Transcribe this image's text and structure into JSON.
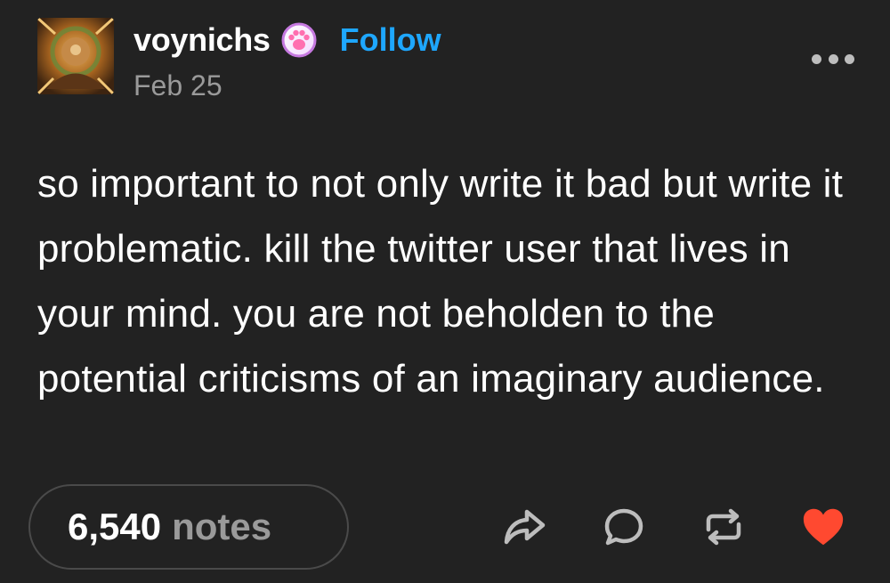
{
  "post": {
    "username": "voynichs",
    "follow_label": "Follow",
    "date": "Feb 25",
    "body": "so important to not only write it bad but write it problematic. kill the twitter user that lives in your mind. you are not beholden to the potential criticisms of an imaginary audience.",
    "notes_count": "6,540",
    "notes_label": "notes"
  },
  "icons": {
    "badge": "paw-badge-icon",
    "more": "more-options-icon",
    "share": "share-icon",
    "reply": "reply-icon",
    "reblog": "reblog-icon",
    "like": "heart-icon"
  },
  "colors": {
    "background": "#222222",
    "follow": "#1ea7ff",
    "like": "#ff4930",
    "muted": "#9a9a9a"
  }
}
